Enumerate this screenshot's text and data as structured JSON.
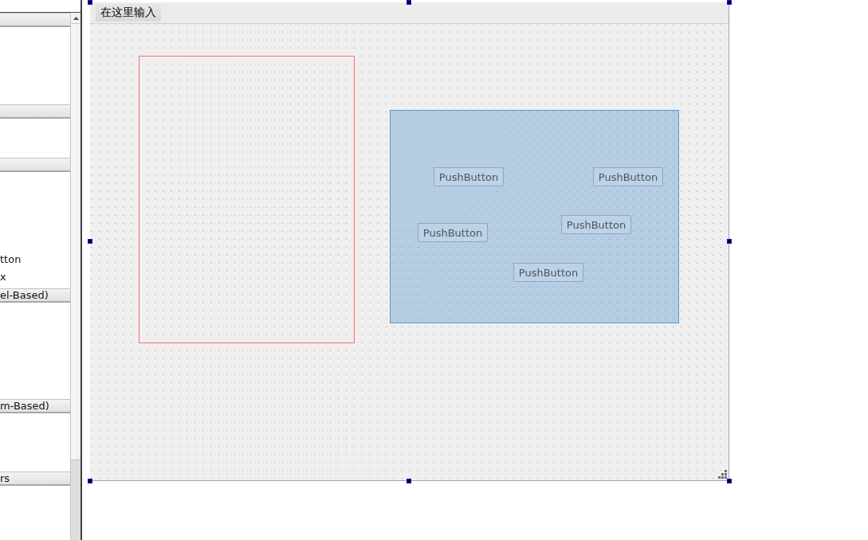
{
  "widget_box": {
    "sections": [
      {
        "expanded": true
      },
      {
        "expanded": true
      },
      {
        "expanded": true,
        "items": [
          "tton",
          "x"
        ]
      },
      {
        "title": "el-Based)",
        "expanded": true
      },
      {
        "title": "m-Based)",
        "expanded": true
      },
      {
        "title": "rs",
        "expanded": true
      }
    ]
  },
  "form": {
    "selected": true,
    "menu_bar": {
      "items": [
        "在这里输入"
      ]
    },
    "selection_area": {
      "buttons": [
        "PushButton",
        "PushButton",
        "PushButton",
        "PushButton",
        "PushButton"
      ]
    }
  }
}
